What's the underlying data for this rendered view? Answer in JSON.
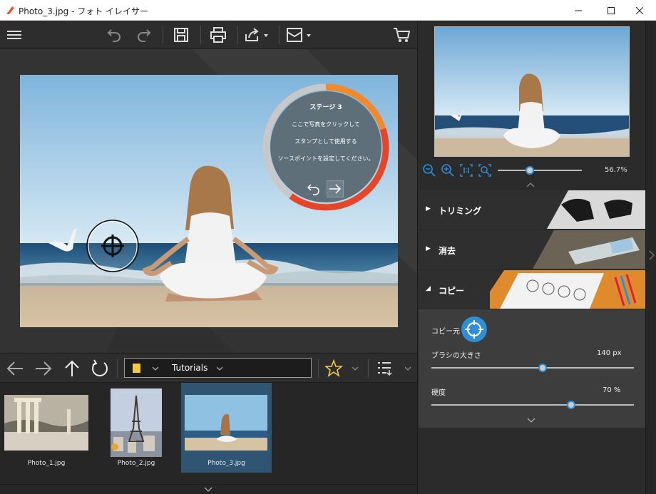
{
  "window": {
    "title": "Photo_3.jpg - フォト イレイサー",
    "controls": [
      "minimize",
      "maximize",
      "close"
    ]
  },
  "toolbar": {
    "icons": [
      "menu-icon",
      "undo-icon",
      "redo-icon",
      "save-icon",
      "print-icon",
      "share-icon",
      "email-icon",
      "cart-icon"
    ]
  },
  "tutorial": {
    "stage": "ステージ 3",
    "line1": "ここで写真をクリックして",
    "line2": "スタンプとして使用する",
    "line3": "ソースポイントを設定してください。",
    "progress": 0.55
  },
  "navigator": {
    "zoom_label": "56.7%",
    "zoom_fraction": 0.38
  },
  "sections": [
    {
      "label": "トリミング",
      "expanded": false
    },
    {
      "label": "消去",
      "expanded": false
    },
    {
      "label": "コピー",
      "expanded": true
    }
  ],
  "copy_panel": {
    "source_label": "コピー元",
    "brush_label": "ブラシの大きさ",
    "brush_value": "140 px",
    "brush_fraction": 0.55,
    "hardness_label": "硬度",
    "hardness_value": "70 %",
    "hardness_fraction": 0.69
  },
  "navbar": {
    "folder_name": "Tutorials"
  },
  "thumbnails": [
    {
      "name": "Photo_1.jpg",
      "selected": false
    },
    {
      "name": "Photo_2.jpg",
      "selected": false
    },
    {
      "name": "Photo_3.jpg",
      "selected": true
    }
  ],
  "colors": {
    "accent": "#2e8fd6",
    "ring_orange": "#f08a2c",
    "ring_red": "#e5462a",
    "selected_thumb": "#2f5573"
  }
}
